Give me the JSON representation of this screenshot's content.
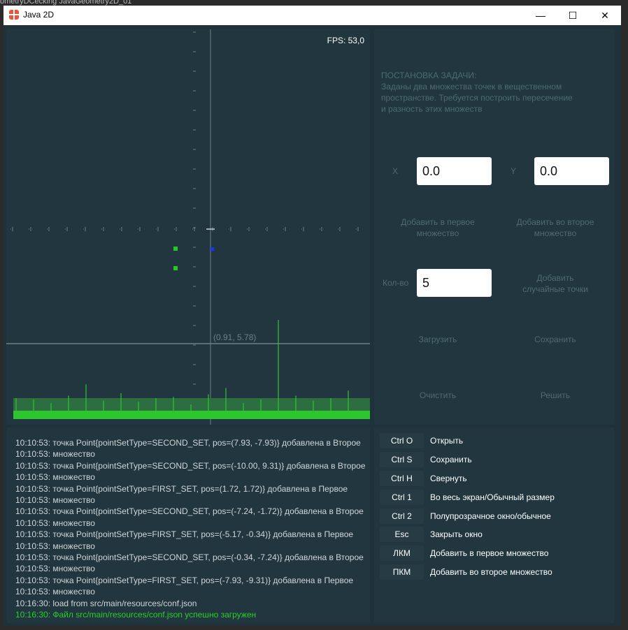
{
  "background": {
    "editor_fragment": "ometryDCecking JavaGeometry2D_01"
  },
  "window": {
    "title": "Java 2D",
    "controls": {
      "minimize": "—",
      "maximize": "☐",
      "close": "✕"
    }
  },
  "canvas": {
    "fps": "FPS: 53,0",
    "cursor_label": "(0.91, 5.78)",
    "colors": {
      "first_set": "#22cc22",
      "second_set": "#1a33ff",
      "axes": "#6d8088",
      "fps_graph": "#2ec62e"
    },
    "fps_graph_spikes": [
      1.0,
      0.9,
      0.6,
      1.2,
      2.1,
      0.8,
      1.4,
      0.7,
      1.0,
      1.1,
      0.5,
      1.3,
      1.8,
      0.6,
      0.9,
      7.5,
      1.2,
      0.8,
      1.0,
      1.6
    ]
  },
  "task": {
    "heading": "ПОСТАНОВКА ЗАДАЧИ:",
    "lines": [
      "Заданы два множества точек в вещественном",
      "пространстве. Требуется построить пересечение",
      "и разность этих множеств"
    ]
  },
  "controls": {
    "x_label": "X",
    "x_value": "0.0",
    "y_label": "Y",
    "y_value": "0.0",
    "add_first": [
      "Добавить в первое",
      "множество"
    ],
    "add_second": [
      "Добавить во второе",
      "множество"
    ],
    "count_label": "Кол-во",
    "count_value": "5",
    "add_random": [
      "Добавить",
      "случайные точки"
    ],
    "load": "Загрузить",
    "save": "Сохранить",
    "clear": "Очистить",
    "solve": "Решить"
  },
  "log": [
    "10:10:53: точка Point{pointSetType=SECOND_SET, pos=(7.93, -7.93)} добавлена в Второе",
    "10:10:53: множество",
    "10:10:53: точка Point{pointSetType=SECOND_SET, pos=(-10.00, 9.31)} добавлена в Второе",
    "10:10:53: множество",
    "10:10:53: точка Point{pointSetType=FIRST_SET, pos=(1.72, 1.72)} добавлена в Первое",
    "10:10:53: множество",
    "10:10:53: точка Point{pointSetType=SECOND_SET, pos=(-7.24, -1.72)} добавлена в Второе",
    "10:10:53: множество",
    "10:10:53: точка Point{pointSetType=FIRST_SET, pos=(-5.17, -0.34)} добавлена в Первое",
    "10:10:53: множество",
    "10:10:53: точка Point{pointSetType=SECOND_SET, pos=(-0.34, -7.24)} добавлена в Второе",
    "10:10:53: множество",
    "10:10:53: точка Point{pointSetType=FIRST_SET, pos=(-7.93, -9.31)} добавлена в Первое",
    "10:10:53: множество",
    "10:16:30: load from src/main/resources/conf.json"
  ],
  "log_success": "10:16:30: Файл src/main/resources/conf.json успешно загружен",
  "shortcuts": [
    {
      "key": "Ctrl O",
      "desc": "Открыть"
    },
    {
      "key": "Ctrl S",
      "desc": "Сохранить"
    },
    {
      "key": "Ctrl H",
      "desc": "Свернуть"
    },
    {
      "key": "Ctrl 1",
      "desc": "Во весь экран/Обычный размер"
    },
    {
      "key": "Ctrl 2",
      "desc": "Полупрозрачное окно/обычное"
    },
    {
      "key": "Esc",
      "desc": "Закрыть окно"
    },
    {
      "key": "ЛКМ",
      "desc": "Добавить в первое множество"
    },
    {
      "key": "ПКМ",
      "desc": "Добавить во второе множество"
    }
  ]
}
